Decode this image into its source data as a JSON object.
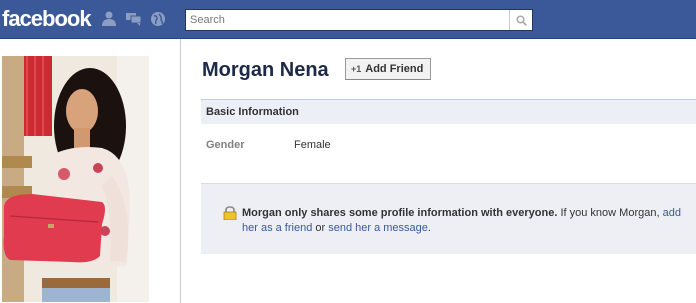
{
  "header": {
    "logo": "facebook",
    "icons": [
      "friend-requests-icon",
      "messages-icon",
      "notifications-globe-icon"
    ],
    "search_placeholder": "Search"
  },
  "profile": {
    "name": "Morgan Nena",
    "add_friend_label": "Add Friend",
    "add_friend_icon_text": "+1"
  },
  "basic_info": {
    "title": "Basic Information",
    "gender_label": "Gender",
    "gender_value": "Female"
  },
  "privacy_notice": {
    "bold_text": "Morgan only shares some profile information with everyone.",
    "text_1": " If you know Morgan, ",
    "link_add": "add her as a friend",
    "text_2": " or ",
    "link_message": "send her a message",
    "text_3": "."
  },
  "colors": {
    "brand_blue": "#3b5998",
    "section_bg": "#eceff5",
    "name_color": "#1c2a47"
  }
}
